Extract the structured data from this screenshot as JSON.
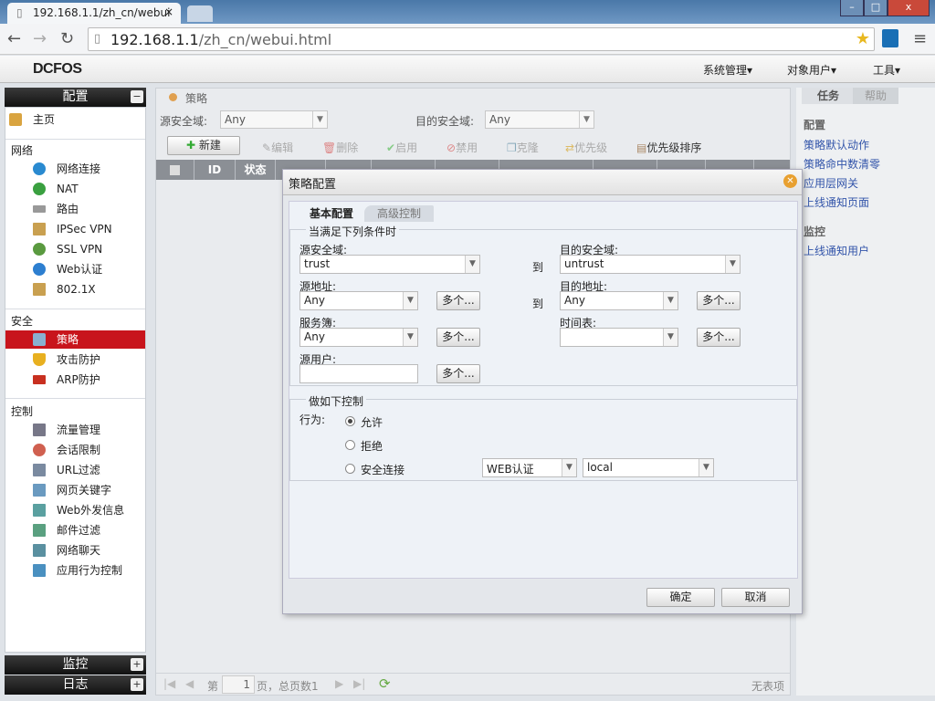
{
  "browser": {
    "tab_title": "192.168.1.1/zh_cn/webui",
    "url_host": "192.168.1.1",
    "url_path": "/zh_cn/webui.html",
    "tab_close": "×",
    "win_min": "–",
    "win_max": "□",
    "win_close": "x"
  },
  "app": {
    "logo": "DCFOS",
    "menus": [
      "系统管理▾",
      "对象用户▾",
      "工具▾"
    ]
  },
  "sidebar": {
    "config_title": "配置",
    "collapse": "−",
    "expand": "+",
    "home": "主页",
    "groups": [
      {
        "title": "网络",
        "items": [
          "网络连接",
          "NAT",
          "路由",
          "IPSec VPN",
          "SSL VPN",
          "Web认证",
          "802.1X"
        ]
      },
      {
        "title": "安全",
        "items": [
          "策略",
          "攻击防护",
          "ARP防护"
        ],
        "active": "策略"
      },
      {
        "title": "控制",
        "items": [
          "流量管理",
          "会话限制",
          "URL过滤",
          "网页关键字",
          "Web外发信息",
          "邮件过滤",
          "网络聊天",
          "应用行为控制"
        ]
      }
    ],
    "monitor_title": "监控",
    "log_title": "日志"
  },
  "main": {
    "breadcrumb": "策略",
    "src_zone_label": "源安全域:",
    "src_zone_value": "Any",
    "dst_zone_label": "目的安全域:",
    "dst_zone_value": "Any",
    "toolbar": [
      "新建",
      "编辑",
      "删除",
      "启用",
      "禁用",
      "克隆",
      "优先级",
      "优先级排序"
    ],
    "table_headers": [
      "ID",
      "状态"
    ],
    "pager": {
      "page_prefix": "第",
      "page_value": "1",
      "page_suffix": "页，总页数1",
      "empty": "无表项"
    }
  },
  "right": {
    "tabs": [
      "任务",
      "帮助"
    ],
    "config_head": "配置",
    "config_links": [
      "策略默认动作",
      "策略命中数清零",
      "应用层网关",
      "上线通知页面"
    ],
    "monitor_head": "监控",
    "monitor_links": [
      "上线通知用户"
    ]
  },
  "dialog": {
    "title": "策略配置",
    "tabs": [
      "基本配置",
      "高级控制"
    ],
    "cond_legend": "当满足下列条件时",
    "src_zone_label": "源安全域:",
    "src_zone": "trust",
    "dst_zone_label": "目的安全域:",
    "dst_zone": "untrust",
    "to": "到",
    "src_addr_label": "源地址:",
    "src_addr": "Any",
    "dst_addr_label": "目的地址:",
    "dst_addr": "Any",
    "service_label": "服务簿:",
    "service": "Any",
    "schedule_label": "时间表:",
    "schedule": "",
    "src_user_label": "源用户:",
    "src_user": "",
    "multi": "多个...",
    "action_legend": "做如下控制",
    "action_label": "行为:",
    "actions": [
      "允许",
      "拒绝",
      "安全连接"
    ],
    "selected_action": "允许",
    "secure_type": "WEB认证",
    "secure_target": "local",
    "ok": "确定",
    "cancel": "取消"
  }
}
